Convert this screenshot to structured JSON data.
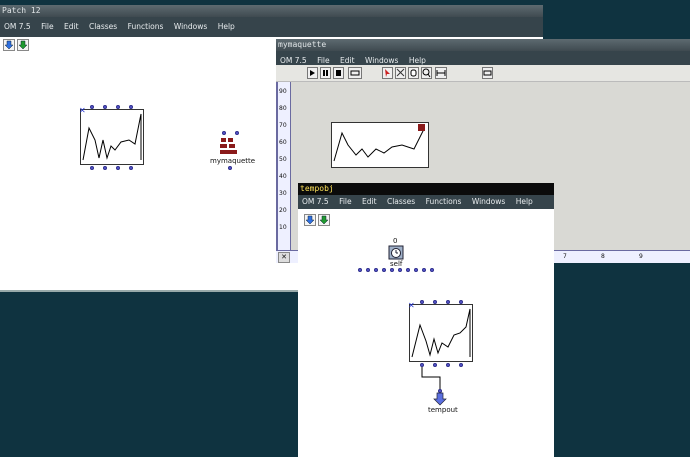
{
  "patch12": {
    "title": "Patch 12",
    "menu": [
      "OM 7.5",
      "File",
      "Edit",
      "Classes",
      "Functions",
      "Windows",
      "Help"
    ],
    "maquette_label": "mymaquette"
  },
  "maquette": {
    "title": "mymaquette",
    "menu": [
      "OM 7.5",
      "File",
      "Edit",
      "Windows",
      "Help"
    ],
    "y_ticks": [
      "90",
      "80",
      "70",
      "60",
      "50",
      "40",
      "30",
      "20",
      "10"
    ],
    "x_ticks": [
      "7",
      "8",
      "9"
    ]
  },
  "tempobj": {
    "title": "tempobj",
    "menu": [
      "OM 7.5",
      "File",
      "Edit",
      "Classes",
      "Functions",
      "Windows",
      "Help"
    ],
    "self_value": "0",
    "self_label": "self",
    "tempout_label": "tempout"
  },
  "colors": {
    "desktop": "#0f3340",
    "menubar": "#36444b",
    "active_title": "#ffe35a"
  }
}
